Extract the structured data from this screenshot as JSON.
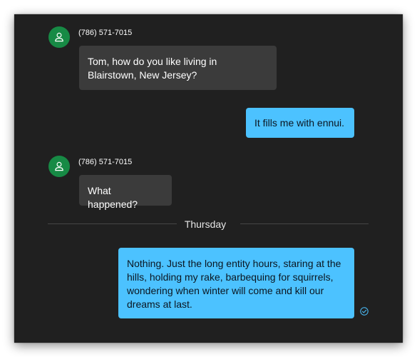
{
  "colors": {
    "background": "#202020",
    "incoming_bubble": "#3b3b3b",
    "outgoing_bubble": "#4cc2ff",
    "avatar": "#178a45"
  },
  "messages": [
    {
      "direction": "incoming",
      "sender": "(786) 571-7015",
      "avatar_icon": "person-icon",
      "text": "Tom, how do you like living in Blairstown, New Jersey?"
    },
    {
      "direction": "outgoing",
      "text": "It fills me with ennui."
    },
    {
      "direction": "incoming",
      "sender": "(786) 571-7015",
      "avatar_icon": "person-icon",
      "text": "What happened?"
    },
    {
      "direction": "outgoing",
      "text": "Nothing.  Just the long entity hours, staring at the hills, holding my rake, barbequing for squirrels, wondering when winter will come and kill our dreams at last.",
      "status_icon": "read-receipt-check-icon"
    }
  ],
  "day_divider": {
    "label": "Thursday"
  }
}
